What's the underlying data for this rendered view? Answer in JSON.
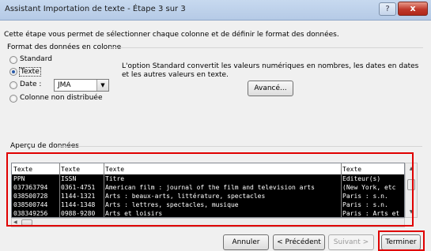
{
  "window": {
    "title": "Assistant Importation de texte - Étape 3 sur 3",
    "help_label": "?",
    "close_label": "x"
  },
  "description": "Cette étape vous permet de sélectionner chaque colonne et de définir le format des données.",
  "format_group": {
    "label": "Format des données en colonne",
    "options": [
      {
        "label": "Standard",
        "checked": false
      },
      {
        "label": "Texte",
        "checked": true
      },
      {
        "label": "Date :",
        "checked": false
      },
      {
        "label": "Colonne non distribuée",
        "checked": false
      }
    ],
    "date_format": "JMA",
    "info_text": "L'option Standard convertit les valeurs numériques en nombres, les dates en dates et les autres valeurs en texte.",
    "advanced_button": "Avancé..."
  },
  "preview": {
    "label": "Aperçu de données",
    "headers": [
      "Texte",
      "Texte",
      "Texte",
      "Texte"
    ],
    "rows": [
      [
        "PPN",
        "ISSN",
        "Titre",
        "Editeur(s)"
      ],
      [
        "037363794",
        "0361-4751",
        "American film : journal of the film and television arts",
        "(New York, etc"
      ],
      [
        "038500728",
        "1144-1321",
        "Arts : beaux-arts, littérature, spectacles",
        "Paris : s.n."
      ],
      [
        "038500744",
        "1144-1348",
        "Arts : lettres, spectacles, musique",
        "Paris : s.n."
      ],
      [
        "038349256",
        "0988-9280",
        "Arts et loisirs",
        "Paris : Arts et"
      ]
    ]
  },
  "buttons": {
    "cancel": "Annuler",
    "previous": "< Précédent",
    "next": "Suivant >",
    "finish": "Terminer"
  },
  "colors": {
    "highlight_red": "#e00000",
    "selection_bg": "#000000"
  }
}
